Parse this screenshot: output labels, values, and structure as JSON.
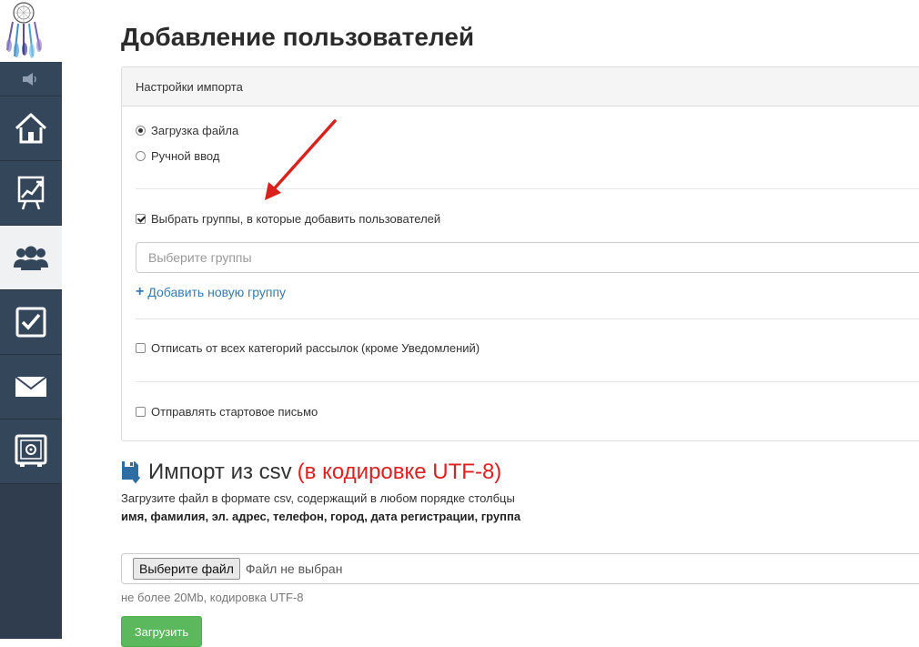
{
  "sidebar": {
    "items": [
      {
        "name": "home",
        "icon": "home-icon"
      },
      {
        "name": "stats",
        "icon": "chart-icon"
      },
      {
        "name": "users",
        "icon": "users-icon",
        "active": true
      },
      {
        "name": "tasks",
        "icon": "checkbox-icon"
      },
      {
        "name": "mail",
        "icon": "envelope-icon"
      },
      {
        "name": "safe",
        "icon": "safe-icon"
      }
    ]
  },
  "page": {
    "title": "Добавление пользователей"
  },
  "settings": {
    "header": "Настройки импорта",
    "radio_file": "Загрузка файла",
    "radio_manual": "Ручной ввод",
    "choose_groups_label": "Выбрать группы, в которые добавить пользователей",
    "groups_placeholder": "Выберите группы",
    "add_group_label": "Добавить новую группу",
    "unsubscribe_label": "Отписать от всех категорий рассылок (кроме Уведомлений)",
    "send_welcome_label": "Отправлять стартовое письмо"
  },
  "import": {
    "heading": "Импорт из csv",
    "heading_note": "(в кодировке UTF-8)",
    "description": "Загрузите файл в формате csv, содержащий в любом порядке столбцы",
    "columns": "имя, фамилия, эл. адрес, телефон, город, дата регистрации, группа",
    "choose_file_label": "Выберите файл",
    "no_file_label": "Файл не выбран",
    "hint": "не более 20Mb, кодировка UTF-8",
    "upload_label": "Загрузить"
  },
  "colors": {
    "sidebar": "#2f3d4e",
    "accent_link": "#337ab7",
    "upload_green": "#5cb85c",
    "note_red": "#e02020",
    "annotation_arrow": "#d9221c"
  }
}
